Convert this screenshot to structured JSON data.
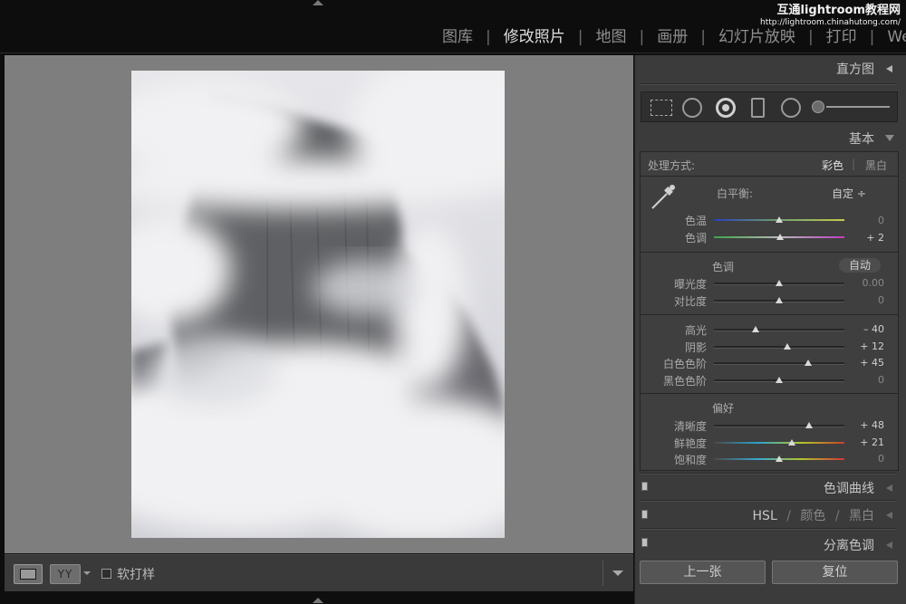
{
  "watermark": {
    "line1": "互通lightroom教程网",
    "line2": "http://lightroom.chinahutong.com/"
  },
  "modules": [
    {
      "label": "图库",
      "active": false
    },
    {
      "label": "修改照片",
      "active": true
    },
    {
      "label": "地图",
      "active": false
    },
    {
      "label": "画册",
      "active": false
    },
    {
      "label": "幻灯片放映",
      "active": false
    },
    {
      "label": "打印",
      "active": false
    },
    {
      "label": "Web",
      "active": false
    }
  ],
  "toolbar": {
    "soft_proof_label": "软打样",
    "view_yy": "YY",
    "soft_proof_checked": false
  },
  "panels": {
    "histogram": "直方图",
    "basic": "基本",
    "tone_curve": "色调曲线",
    "hsl": "HSL",
    "color": "颜色",
    "bw": "黑白",
    "split_toning": "分离色调",
    "hsl_sep": "/"
  },
  "basic": {
    "treatment_label": "处理方式:",
    "color": "彩色",
    "bw": "黑白",
    "wb_label": "白平衡:",
    "wb_value": "自定 ÷",
    "tone_label": "色调",
    "auto": "自动",
    "presence_label": "偏好"
  },
  "sliders": {
    "temp": {
      "label": "色温",
      "value": "0",
      "level": 0.5
    },
    "tint": {
      "label": "色调",
      "value": "+ 2",
      "level": 0.51
    },
    "exposure": {
      "label": "曝光度",
      "value": "0.00",
      "level": 0.5
    },
    "contrast": {
      "label": "对比度",
      "value": "0",
      "level": 0.5
    },
    "highlights": {
      "label": "高光",
      "value": "– 40",
      "level": 0.32
    },
    "shadows": {
      "label": "阴影",
      "value": "+ 12",
      "level": 0.56
    },
    "whites": {
      "label": "白色色阶",
      "value": "+ 45",
      "level": 0.72
    },
    "blacks": {
      "label": "黑色色阶",
      "value": "0",
      "level": 0.5
    },
    "clarity": {
      "label": "清晰度",
      "value": "+ 48",
      "level": 0.73
    },
    "vibrance": {
      "label": "鲜艳度",
      "value": "+ 21",
      "level": 0.6
    },
    "saturation": {
      "label": "饱和度",
      "value": "0",
      "level": 0.5
    }
  },
  "buttons": {
    "previous": "上一张",
    "reset": "复位"
  },
  "colors": {
    "panel_bg": "#3b3b3b",
    "canvas_bg": "#7e7e7e",
    "active_module": "#dcdcdc"
  }
}
